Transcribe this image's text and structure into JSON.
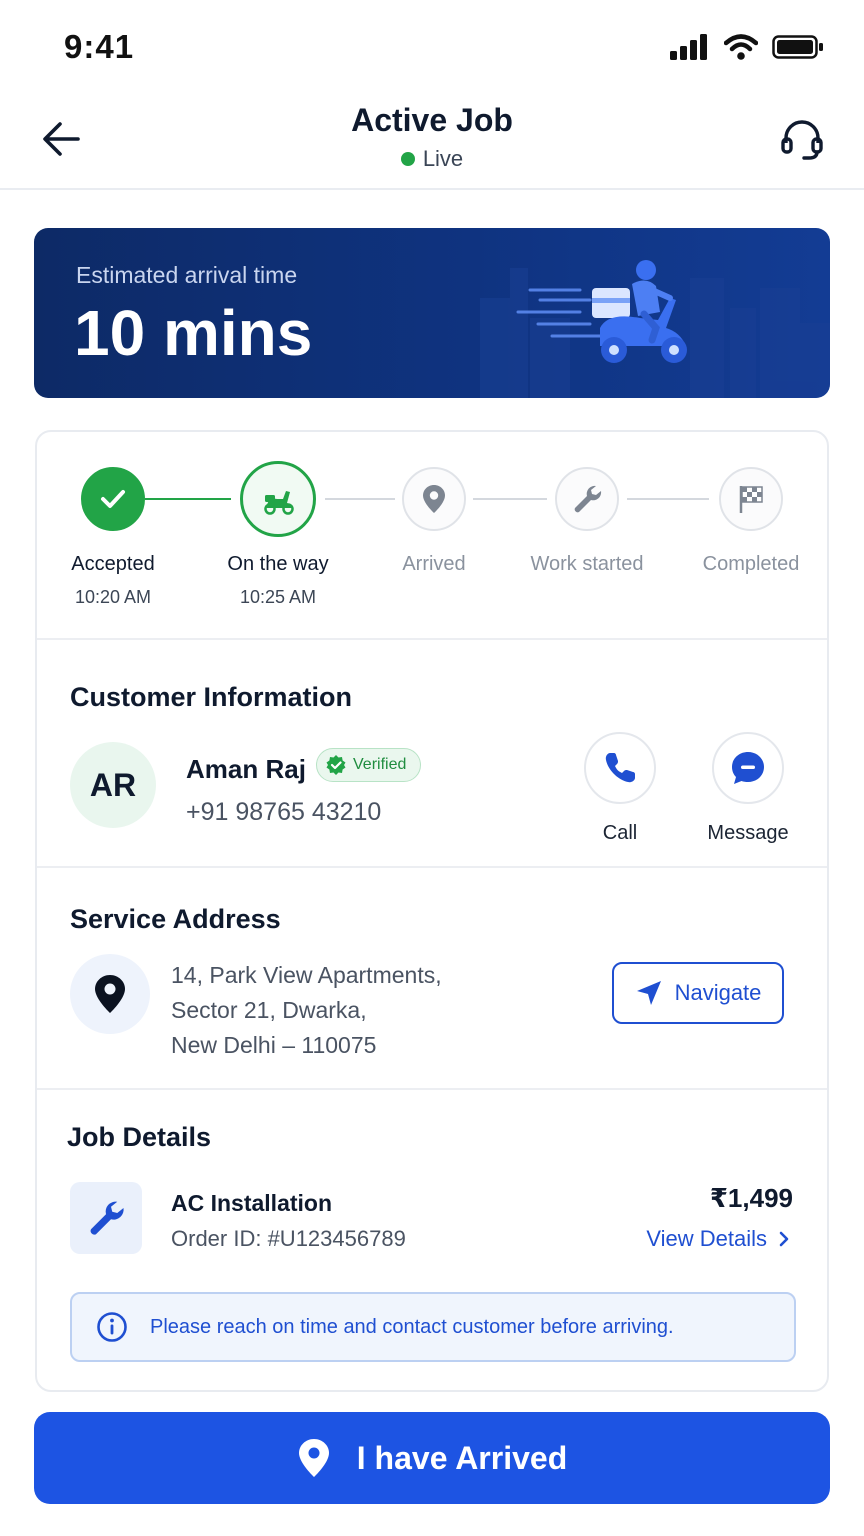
{
  "status_bar": {
    "time": "9:41"
  },
  "header": {
    "title": "Active Job",
    "status": "Live"
  },
  "eta": {
    "label": "Estimated arrival time",
    "value": "10 mins"
  },
  "steps": [
    {
      "label": "Accepted",
      "time": "10:20 AM",
      "state": "done",
      "icon": "checkmark-icon"
    },
    {
      "label": "On the way",
      "time": "10:25 AM",
      "state": "current",
      "icon": "scooter-icon"
    },
    {
      "label": "Arrived",
      "time": "",
      "state": "pending",
      "icon": "location-pin-icon"
    },
    {
      "label": "Work started",
      "time": "",
      "state": "pending",
      "icon": "wrench-icon"
    },
    {
      "label": "Completed",
      "time": "",
      "state": "pending",
      "icon": "checkered-flag-icon"
    }
  ],
  "customer": {
    "section_title": "Customer Information",
    "initials": "AR",
    "name": "Aman Raj",
    "verified_label": "Verified",
    "phone": "+91 98765 43210",
    "call_label": "Call",
    "message_label": "Message"
  },
  "address": {
    "section_title": "Service Address",
    "lines": [
      "14, Park View Apartments,",
      "Sector 21, Dwarka,",
      "New Delhi – 110075"
    ],
    "navigate_label": "Navigate"
  },
  "job": {
    "section_title": "Job Details",
    "service": "AC Installation",
    "order_id": "Order ID: #U123456789",
    "price": "₹1,499",
    "view_details_label": "View Details",
    "note": "Please reach on time and contact customer before arriving."
  },
  "cta": {
    "label": "I have Arrived"
  },
  "colors": {
    "primary": "#1d54e3",
    "success": "#22a447",
    "banner": "#0f3380",
    "text": "#0f1a2e"
  }
}
